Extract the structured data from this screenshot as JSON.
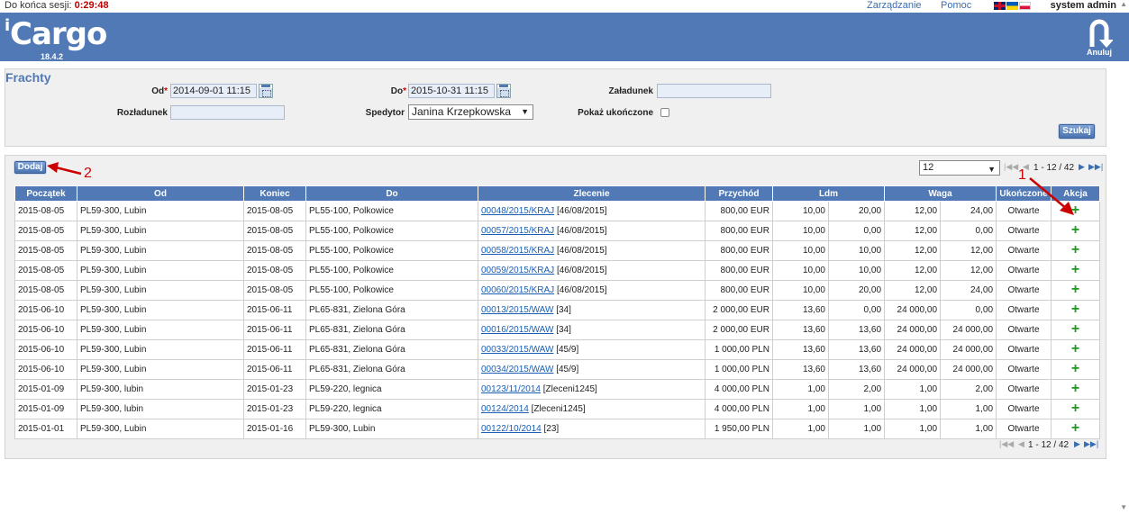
{
  "session": {
    "label": "Do końca sesji:",
    "time": "0:29:48"
  },
  "topmenu": {
    "manage": "Zarządzanie",
    "help": "Pomoc",
    "user": "system admin"
  },
  "header": {
    "logo_prefix": "i",
    "logo": "Cargo",
    "version": "18.4.2",
    "cancel_label": "Anuluj"
  },
  "filters": {
    "title": "Frachty",
    "from_label": "Od",
    "from_value": "2014-09-01 11:15",
    "to_label": "Do",
    "to_value": "2015-10-31 11:15",
    "loading_label": "Załadunek",
    "loading_value": "",
    "unloading_label": "Rozładunek",
    "unloading_value": "",
    "forwarder_label": "Spedytor",
    "forwarder_value": "Janina Krzepkowska",
    "show_done_label": "Pokaż ukończone",
    "search_button": "Szukaj"
  },
  "results": {
    "add_button": "Dodaj",
    "page_size": "12",
    "pager_text": "1 - 12 / 42",
    "columns": [
      "Początek",
      "Od",
      "Koniec",
      "Do",
      "Zlecenie",
      "Przychód",
      "Ldm",
      "Waga",
      "Ukończone",
      "Akcja"
    ],
    "rows": [
      {
        "start": "2015-08-05",
        "from": "PL59-300, Lubin",
        "end": "2015-08-05",
        "to": "PL55-100, Polkowice",
        "order": "00048/2015/KRAJ",
        "order_ref": "[46/08/2015]",
        "income": "800,00 EUR",
        "ldm1": "10,00",
        "ldm2": "20,00",
        "w1": "12,00",
        "w2": "24,00",
        "status": "Otwarte"
      },
      {
        "start": "2015-08-05",
        "from": "PL59-300, Lubin",
        "end": "2015-08-05",
        "to": "PL55-100, Polkowice",
        "order": "00057/2015/KRAJ",
        "order_ref": "[46/08/2015]",
        "income": "800,00 EUR",
        "ldm1": "10,00",
        "ldm2": "0,00",
        "w1": "12,00",
        "w2": "0,00",
        "status": "Otwarte"
      },
      {
        "start": "2015-08-05",
        "from": "PL59-300, Lubin",
        "end": "2015-08-05",
        "to": "PL55-100, Polkowice",
        "order": "00058/2015/KRAJ",
        "order_ref": "[46/08/2015]",
        "income": "800,00 EUR",
        "ldm1": "10,00",
        "ldm2": "10,00",
        "w1": "12,00",
        "w2": "12,00",
        "status": "Otwarte"
      },
      {
        "start": "2015-08-05",
        "from": "PL59-300, Lubin",
        "end": "2015-08-05",
        "to": "PL55-100, Polkowice",
        "order": "00059/2015/KRAJ",
        "order_ref": "[46/08/2015]",
        "income": "800,00 EUR",
        "ldm1": "10,00",
        "ldm2": "10,00",
        "w1": "12,00",
        "w2": "12,00",
        "status": "Otwarte"
      },
      {
        "start": "2015-08-05",
        "from": "PL59-300, Lubin",
        "end": "2015-08-05",
        "to": "PL55-100, Polkowice",
        "order": "00060/2015/KRAJ",
        "order_ref": "[46/08/2015]",
        "income": "800,00 EUR",
        "ldm1": "10,00",
        "ldm2": "20,00",
        "w1": "12,00",
        "w2": "24,00",
        "status": "Otwarte"
      },
      {
        "start": "2015-06-10",
        "from": "PL59-300, Lubin",
        "end": "2015-06-11",
        "to": "PL65-831, Zielona Góra",
        "order": "00013/2015/WAW",
        "order_ref": "[34]",
        "income": "2 000,00 EUR",
        "ldm1": "13,60",
        "ldm2": "0,00",
        "w1": "24 000,00",
        "w2": "0,00",
        "status": "Otwarte"
      },
      {
        "start": "2015-06-10",
        "from": "PL59-300, Lubin",
        "end": "2015-06-11",
        "to": "PL65-831, Zielona Góra",
        "order": "00016/2015/WAW",
        "order_ref": "[34]",
        "income": "2 000,00 EUR",
        "ldm1": "13,60",
        "ldm2": "13,60",
        "w1": "24 000,00",
        "w2": "24 000,00",
        "status": "Otwarte"
      },
      {
        "start": "2015-06-10",
        "from": "PL59-300, Lubin",
        "end": "2015-06-11",
        "to": "PL65-831, Zielona Góra",
        "order": "00033/2015/WAW",
        "order_ref": "[45/9]",
        "income": "1 000,00 PLN",
        "ldm1": "13,60",
        "ldm2": "13,60",
        "w1": "24 000,00",
        "w2": "24 000,00",
        "status": "Otwarte"
      },
      {
        "start": "2015-06-10",
        "from": "PL59-300, Lubin",
        "end": "2015-06-11",
        "to": "PL65-831, Zielona Góra",
        "order": "00034/2015/WAW",
        "order_ref": "[45/9]",
        "income": "1 000,00 PLN",
        "ldm1": "13,60",
        "ldm2": "13,60",
        "w1": "24 000,00",
        "w2": "24 000,00",
        "status": "Otwarte"
      },
      {
        "start": "2015-01-09",
        "from": "PL59-300, lubin",
        "end": "2015-01-23",
        "to": "PL59-220, legnica",
        "order": "00123/11/2014",
        "order_ref": "[Zleceni1245]",
        "income": "4 000,00 PLN",
        "ldm1": "1,00",
        "ldm2": "2,00",
        "w1": "1,00",
        "w2": "2,00",
        "status": "Otwarte"
      },
      {
        "start": "2015-01-09",
        "from": "PL59-300, lubin",
        "end": "2015-01-23",
        "to": "PL59-220, legnica",
        "order": "00124/2014",
        "order_ref": "[Zleceni1245]",
        "income": "4 000,00 PLN",
        "ldm1": "1,00",
        "ldm2": "1,00",
        "w1": "1,00",
        "w2": "1,00",
        "status": "Otwarte"
      },
      {
        "start": "2015-01-01",
        "from": "PL59-300, Lubin",
        "end": "2015-01-16",
        "to": "PL59-300, Lubin",
        "order": "00122/10/2014",
        "order_ref": "[23]",
        "income": "1 950,00 PLN",
        "ldm1": "1,00",
        "ldm2": "1,00",
        "w1": "1,00",
        "w2": "1,00",
        "status": "Otwarte"
      }
    ]
  },
  "annotations": {
    "a1": "1",
    "a2": "2"
  },
  "colors": {
    "header": "#5179b5",
    "accent_red": "#cc0000",
    "plus_green": "#1f9a1f"
  }
}
